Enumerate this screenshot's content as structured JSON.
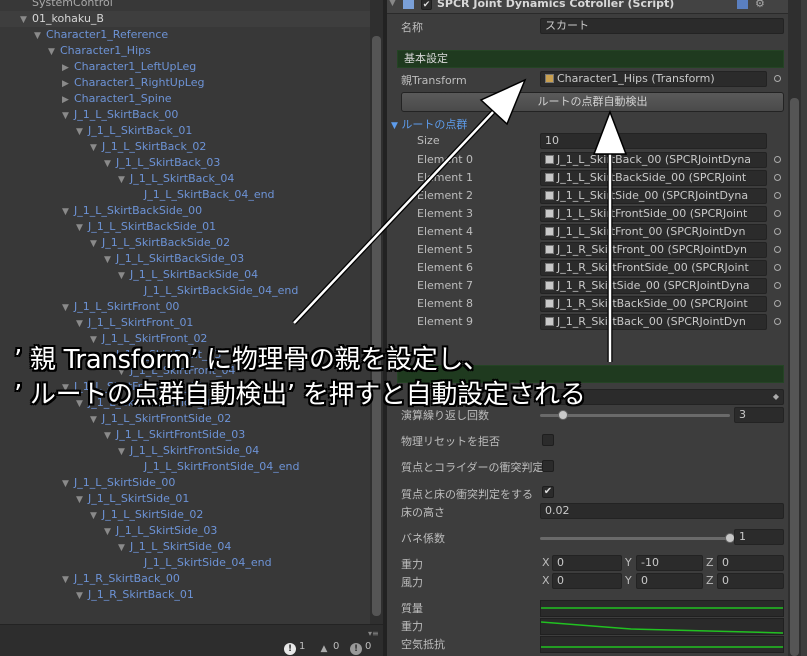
{
  "hierarchy": {
    "rows": [
      {
        "text": "SystemControl",
        "indent": 0,
        "arrow": "",
        "style": "dim"
      },
      {
        "text": "01_kohaku_B",
        "indent": 0,
        "arrow": "▼",
        "style": "sel"
      },
      {
        "text": "Character1_Reference",
        "indent": 1,
        "arrow": "▼",
        "style": ""
      },
      {
        "text": "Character1_Hips",
        "indent": 2,
        "arrow": "▼",
        "style": ""
      },
      {
        "text": "Character1_LeftUpLeg",
        "indent": 3,
        "arrow": "▶",
        "style": ""
      },
      {
        "text": "Character1_RightUpLeg",
        "indent": 3,
        "arrow": "▶",
        "style": ""
      },
      {
        "text": "Character1_Spine",
        "indent": 3,
        "arrow": "▶",
        "style": ""
      },
      {
        "text": "J_1_L_SkirtBack_00",
        "indent": 3,
        "arrow": "▼",
        "style": ""
      },
      {
        "text": "J_1_L_SkirtBack_01",
        "indent": 4,
        "arrow": "▼",
        "style": ""
      },
      {
        "text": "J_1_L_SkirtBack_02",
        "indent": 5,
        "arrow": "▼",
        "style": ""
      },
      {
        "text": "J_1_L_SkirtBack_03",
        "indent": 6,
        "arrow": "▼",
        "style": ""
      },
      {
        "text": "J_1_L_SkirtBack_04",
        "indent": 7,
        "arrow": "▼",
        "style": ""
      },
      {
        "text": "J_1_L_SkirtBack_04_end",
        "indent": 8,
        "arrow": "",
        "style": ""
      },
      {
        "text": "J_1_L_SkirtBackSide_00",
        "indent": 3,
        "arrow": "▼",
        "style": ""
      },
      {
        "text": "J_1_L_SkirtBackSide_01",
        "indent": 4,
        "arrow": "▼",
        "style": ""
      },
      {
        "text": "J_1_L_SkirtBackSide_02",
        "indent": 5,
        "arrow": "▼",
        "style": ""
      },
      {
        "text": "J_1_L_SkirtBackSide_03",
        "indent": 6,
        "arrow": "▼",
        "style": ""
      },
      {
        "text": "J_1_L_SkirtBackSide_04",
        "indent": 7,
        "arrow": "▼",
        "style": ""
      },
      {
        "text": "J_1_L_SkirtBackSide_04_end",
        "indent": 8,
        "arrow": "",
        "style": ""
      },
      {
        "text": "J_1_L_SkirtFront_00",
        "indent": 3,
        "arrow": "▼",
        "style": ""
      },
      {
        "text": "J_1_L_SkirtFront_01",
        "indent": 4,
        "arrow": "▼",
        "style": ""
      },
      {
        "text": "J_1_L_SkirtFront_02",
        "indent": 5,
        "arrow": "▼",
        "style": ""
      },
      {
        "text": "J_1_L_SkirtFront_03",
        "indent": 6,
        "arrow": "▼",
        "style": ""
      },
      {
        "text": "J_1_L_SkirtFront_04",
        "indent": 7,
        "arrow": "▼",
        "style": ""
      },
      {
        "text": "J_1_L_SkirtFrontSide_00",
        "indent": 3,
        "arrow": "▼",
        "style": ""
      },
      {
        "text": "J_1_L_SkirtFrontSide_01",
        "indent": 4,
        "arrow": "▼",
        "style": ""
      },
      {
        "text": "J_1_L_SkirtFrontSide_02",
        "indent": 5,
        "arrow": "▼",
        "style": ""
      },
      {
        "text": "J_1_L_SkirtFrontSide_03",
        "indent": 6,
        "arrow": "▼",
        "style": ""
      },
      {
        "text": "J_1_L_SkirtFrontSide_04",
        "indent": 7,
        "arrow": "▼",
        "style": ""
      },
      {
        "text": "J_1_L_SkirtFrontSide_04_end",
        "indent": 8,
        "arrow": "",
        "style": ""
      },
      {
        "text": "J_1_L_SkirtSide_00",
        "indent": 3,
        "arrow": "▼",
        "style": ""
      },
      {
        "text": "J_1_L_SkirtSide_01",
        "indent": 4,
        "arrow": "▼",
        "style": ""
      },
      {
        "text": "J_1_L_SkirtSide_02",
        "indent": 5,
        "arrow": "▼",
        "style": ""
      },
      {
        "text": "J_1_L_SkirtSide_03",
        "indent": 6,
        "arrow": "▼",
        "style": ""
      },
      {
        "text": "J_1_L_SkirtSide_04",
        "indent": 7,
        "arrow": "▼",
        "style": ""
      },
      {
        "text": "J_1_L_SkirtSide_04_end",
        "indent": 8,
        "arrow": "",
        "style": ""
      },
      {
        "text": "J_1_R_SkirtBack_00",
        "indent": 3,
        "arrow": "▼",
        "style": ""
      },
      {
        "text": "J_1_R_SkirtBack_01",
        "indent": 4,
        "arrow": "▼",
        "style": ""
      }
    ],
    "status": {
      "errors": "1",
      "warnings": "0",
      "infos": "0"
    }
  },
  "inspector": {
    "component_title": "SPCR Joint Dynamics Cotroller (Script)",
    "name_label": "名称",
    "name_value": "スカート",
    "basic_section": "基本設定",
    "parent_label": "親Transform",
    "parent_value": "Character1_Hips (Transform)",
    "auto_detect_button": "ルートの点群自動検出",
    "root_points_label": "ルートの点群",
    "size_label": "Size",
    "size_value": "10",
    "elements": [
      {
        "label": "Element 0",
        "value": "J_1_L_SkirtBack_00 (SPCRJointDyna"
      },
      {
        "label": "Element 1",
        "value": "J_1_L_SkirtBackSide_00 (SPCRJoint"
      },
      {
        "label": "Element 2",
        "value": "J_1_L_SkirtSide_00 (SPCRJointDyna"
      },
      {
        "label": "Element 3",
        "value": "J_1_L_SkirtFrontSide_00 (SPCRJoint"
      },
      {
        "label": "Element 4",
        "value": "J_1_L_SkirtFront_00 (SPCRJointDyn"
      },
      {
        "label": "Element 5",
        "value": "J_1_R_SkirtFront_00 (SPCRJointDyn"
      },
      {
        "label": "Element 6",
        "value": "J_1_R_SkirtFrontSide_00 (SPCRJoint"
      },
      {
        "label": "Element 7",
        "value": "J_1_R_SkirtSide_00 (SPCRJointDyna"
      },
      {
        "label": "Element 8",
        "value": "J_1_R_SkirtBackSide_00 (SPCRJoint"
      },
      {
        "label": "Element 9",
        "value": "J_1_R_SkirtBack_00 (SPCRJointDyn"
      }
    ],
    "iterations_label": "演算繰り返し回数",
    "iterations_value": "3",
    "iterations_fraction": 0.12,
    "physics_reset_label": "物理リセットを拒否",
    "collider_label": "質点とコライダーの衝突判定",
    "floor_collision_label": "質点と床の衝突判定をする",
    "floor_height_label": "床の高さ",
    "floor_height_value": "0.02",
    "spring_label": "バネ係数",
    "spring_value": "1",
    "spring_fraction": 1.0,
    "gravity_label": "重力",
    "gravity": {
      "x": "0",
      "y": "-10",
      "z": "0"
    },
    "wind_label": "風力",
    "wind": {
      "x": "0",
      "y": "0",
      "z": "0"
    },
    "axis_x": "X",
    "axis_y": "Y",
    "axis_z": "Z",
    "mass_label": "質量",
    "gravity_curve_label": "重力",
    "air_resistance_label": "空気抵抗",
    "curve_color": "#21c121"
  },
  "annotation": {
    "line1": "’ 親 Transform’ に物理骨の親を設定し、",
    "line2": "’ ルートの点群自動検出’ を押すと自動設定される",
    "color": "#ffffff"
  }
}
